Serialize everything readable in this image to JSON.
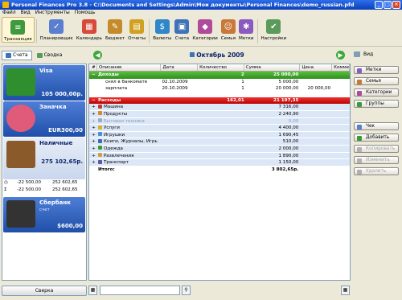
{
  "window": {
    "title": "Personal Finances Pro 3.8 - C:\\Documents and Settings\\Admin\\Мои документы\\Personal Finances\\demo_russian.pfd"
  },
  "menu": [
    "Файл",
    "Вид",
    "Инструменты",
    "Помощь"
  ],
  "toolbar": [
    {
      "label": "Транзакция",
      "icon": "transaction-icon",
      "color": "#3f9a3f"
    },
    {
      "label": "Планировщик",
      "icon": "planner-icon",
      "color": "#5a7fd0"
    },
    {
      "label": "Календарь",
      "icon": "calendar-icon",
      "color": "#d74a3a"
    },
    {
      "label": "Бюджет",
      "icon": "budget-icon",
      "color": "#c58a2a"
    },
    {
      "label": "Отчеты",
      "icon": "reports-icon",
      "color": "#d0a020"
    },
    {
      "label": "Валюты",
      "icon": "currencies-icon",
      "color": "#2f86c8"
    },
    {
      "label": "Счета",
      "icon": "accounts-icon",
      "color": "#3f72b8"
    },
    {
      "label": "Категории",
      "icon": "categories-icon",
      "color": "#b04a9a"
    },
    {
      "label": "Семья",
      "icon": "family-icon",
      "color": "#c9783a"
    },
    {
      "label": "Метки",
      "icon": "tags-icon",
      "color": "#8a5ac0"
    },
    {
      "label": "Настройки",
      "icon": "settings-icon",
      "color": "#5a9a5a"
    }
  ],
  "sidebar": {
    "tabs": [
      "Счета",
      "Сводка"
    ],
    "accounts": [
      {
        "name": "Visa",
        "balance": "105 000,00р.",
        "icon": "visa-card-icon",
        "color": "#2f8f2f"
      },
      {
        "name": "Заначка",
        "balance": "EUR300,00",
        "icon": "piggy-bank-icon",
        "color": "#e05a7a"
      },
      {
        "name": "Наличные",
        "balance": "275 102,65р.",
        "icon": "wallet-icon",
        "color": "#8a5a2a"
      },
      {
        "name": "Сбербанк",
        "sub": "счет",
        "balance": "$600,00",
        "icon": "safe-icon",
        "color": "#333333"
      }
    ],
    "summary": [
      {
        "a": "-22 500,00",
        "b": "252 602,65"
      },
      {
        "a": "-22 500,00",
        "b": "252 602,65"
      }
    ],
    "sverka": "Сверка"
  },
  "month": "Октябрь 2009",
  "view_label": "Вид",
  "grid": {
    "headers": [
      "#",
      "Описание",
      "Дата",
      "Количество",
      "Сумма",
      "Цена",
      "Коммен"
    ],
    "income": {
      "label": "Доходы",
      "qty": "2",
      "sum": "25 000,00"
    },
    "income_rows": [
      {
        "name": "снял в банкомате",
        "date": "02.10.2009",
        "qty": "1",
        "sum": "5 000,00",
        "price": ""
      },
      {
        "name": "зарплата",
        "date": "20.10.2009",
        "qty": "1",
        "sum": "20 000,00",
        "price": "20 000,00"
      }
    ],
    "expense": {
      "label": "Расходы",
      "qty": "162,01",
      "sum": "21 197,35"
    },
    "categories": [
      {
        "name": "Машина",
        "sum": "7 316,00",
        "color": "#c0392b"
      },
      {
        "name": "Продукты",
        "sum": "2 240,90",
        "color": "#d28a2a"
      },
      {
        "name": "Бытовая техника",
        "sum": "0,00",
        "color": "#9aaac8",
        "faded": true
      },
      {
        "name": "Услуги",
        "sum": "4 400,00",
        "color": "#d2b22a"
      },
      {
        "name": "Игрушки",
        "sum": "1 690,45",
        "color": "#4a90d0"
      },
      {
        "name": "Книги, Журналы, Игрь",
        "sum": "510,00",
        "color": "#3a6ab0"
      },
      {
        "name": "Одежда",
        "sum": "2 000,00",
        "color": "#3a9a3a"
      },
      {
        "name": "Развлечения",
        "sum": "1 890,00",
        "color": "#d0a040"
      },
      {
        "name": "Транспорт",
        "sum": "1 150,00",
        "color": "#5a5aa0"
      }
    ],
    "total": {
      "label": "Итого:",
      "sum": "3 802,65р."
    }
  },
  "right_buttons": [
    {
      "label": "Метки",
      "enabled": true,
      "color": "#8a5ac0"
    },
    {
      "label": "Семья",
      "enabled": true,
      "color": "#c9783a"
    },
    {
      "label": "Категории",
      "enabled": true,
      "color": "#b04a9a"
    },
    {
      "label": "Группы",
      "enabled": true,
      "color": "#3a9a3a"
    },
    {
      "label": "Чек",
      "enabled": true,
      "color": "#5a7fd0"
    },
    {
      "label": "Добавить",
      "enabled": true,
      "color": "#3a9a3a"
    },
    {
      "label": "Копировать",
      "enabled": false,
      "color": "#b0b0b0"
    },
    {
      "label": "Изменить",
      "enabled": false,
      "color": "#b0b0b0"
    },
    {
      "label": "Удалить",
      "enabled": false,
      "color": "#b0b0b0"
    }
  ]
}
